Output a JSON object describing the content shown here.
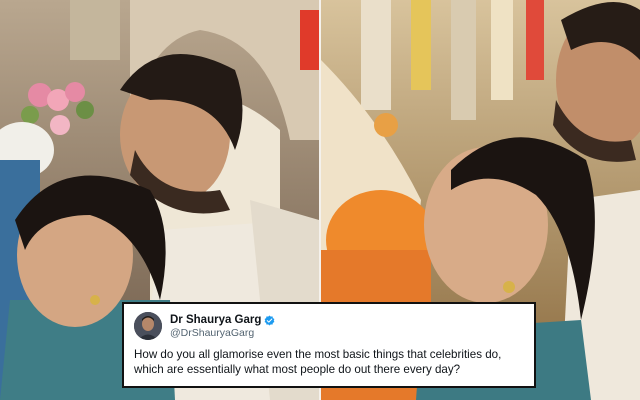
{
  "tweet": {
    "author_name": "Dr Shaurya Garg",
    "author_handle": "@DrShauryaGarg",
    "text": "How do you all glamorise even the most basic things that celebrities do, which are essentially what most people do out there every day?",
    "verified_color": "#1d9bf0"
  },
  "panels": {
    "left_tint": "#b8a690",
    "right_tint": "#c9a45a"
  }
}
